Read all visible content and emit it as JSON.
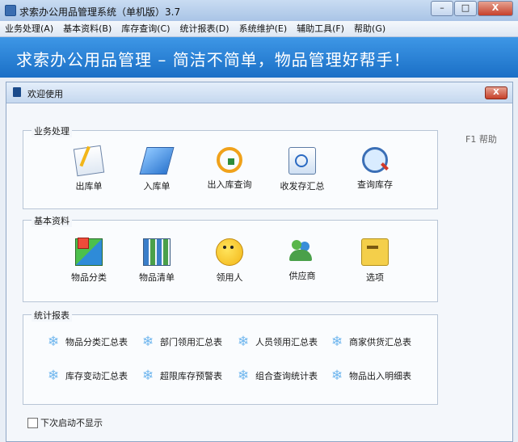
{
  "window": {
    "title": "求索办公用品管理系统（单机版）3.7",
    "buttons": {
      "minimize": "–",
      "maximize": "□",
      "close": "X"
    }
  },
  "menu": [
    {
      "label": "业务处理(A)"
    },
    {
      "label": "基本资料(B)"
    },
    {
      "label": "库存查询(C)"
    },
    {
      "label": "统计报表(D)"
    },
    {
      "label": "系统维护(E)"
    },
    {
      "label": "辅助工具(F)"
    },
    {
      "label": "帮助(G)"
    }
  ],
  "banner": {
    "slogan": "求索办公用品管理 – 简洁不简单，物品管理好帮手！"
  },
  "dialog": {
    "title": "欢迎使用",
    "close_label": "X",
    "help": "F1 帮助",
    "groups": {
      "business": {
        "legend": "业务处理",
        "items": [
          {
            "label": "出库单",
            "icon": "notepad-icon"
          },
          {
            "label": "入库单",
            "icon": "paper-icon"
          },
          {
            "label": "出入库查询",
            "icon": "exchange-arrows-icon"
          },
          {
            "label": "收发存汇总",
            "icon": "clock-report-icon"
          },
          {
            "label": "查询库存",
            "icon": "magnifier-icon"
          }
        ]
      },
      "basic": {
        "legend": "基本资料",
        "items": [
          {
            "label": "物品分类",
            "icon": "cubes-icon"
          },
          {
            "label": "物品清单",
            "icon": "books-icon"
          },
          {
            "label": "领用人",
            "icon": "smiley-face-icon"
          },
          {
            "label": "供应商",
            "icon": "people-icon"
          },
          {
            "label": "选项",
            "icon": "keys-icon"
          }
        ]
      },
      "reports": {
        "legend": "统计报表",
        "items": [
          {
            "label": "物品分类汇总表"
          },
          {
            "label": "部门领用汇总表"
          },
          {
            "label": "人员领用汇总表"
          },
          {
            "label": "商家供货汇总表"
          },
          {
            "label": "库存变动汇总表"
          },
          {
            "label": "超限库存预警表"
          },
          {
            "label": "组合查询统计表"
          },
          {
            "label": "物品出入明细表"
          }
        ]
      }
    },
    "dont_show_label": "下次启动不显示"
  }
}
